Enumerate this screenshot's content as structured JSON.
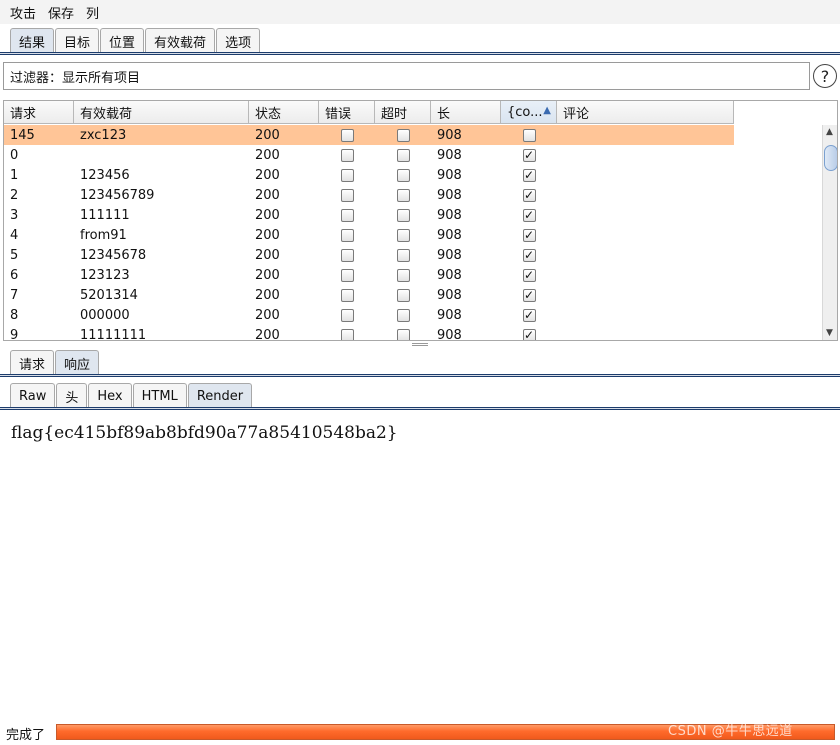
{
  "menu": [
    "攻击",
    "保存",
    "列"
  ],
  "top_tabs": [
    "结果",
    "目标",
    "位置",
    "有效载荷",
    "选项"
  ],
  "filter_text": "过滤器：显示所有项目",
  "help_glyph": "?",
  "table": {
    "columns": [
      "请求",
      "有效载荷",
      "状态",
      "错误",
      "超时",
      "长",
      "{co...",
      "评论"
    ],
    "sorted_column_arrow": "▲",
    "rows": [
      {
        "req": "145",
        "payload": "zxc123",
        "status": "200",
        "error": false,
        "timeout": false,
        "len": "908",
        "co": false,
        "comment": "",
        "selected": true
      },
      {
        "req": "0",
        "payload": "",
        "status": "200",
        "error": false,
        "timeout": false,
        "len": "908",
        "co": true,
        "comment": ""
      },
      {
        "req": "1",
        "payload": "123456",
        "status": "200",
        "error": false,
        "timeout": false,
        "len": "908",
        "co": true,
        "comment": ""
      },
      {
        "req": "2",
        "payload": "123456789",
        "status": "200",
        "error": false,
        "timeout": false,
        "len": "908",
        "co": true,
        "comment": ""
      },
      {
        "req": "3",
        "payload": "111111",
        "status": "200",
        "error": false,
        "timeout": false,
        "len": "908",
        "co": true,
        "comment": ""
      },
      {
        "req": "4",
        "payload": "from91",
        "status": "200",
        "error": false,
        "timeout": false,
        "len": "908",
        "co": true,
        "comment": ""
      },
      {
        "req": "5",
        "payload": "12345678",
        "status": "200",
        "error": false,
        "timeout": false,
        "len": "908",
        "co": true,
        "comment": ""
      },
      {
        "req": "6",
        "payload": "123123",
        "status": "200",
        "error": false,
        "timeout": false,
        "len": "908",
        "co": true,
        "comment": ""
      },
      {
        "req": "7",
        "payload": "5201314",
        "status": "200",
        "error": false,
        "timeout": false,
        "len": "908",
        "co": true,
        "comment": ""
      },
      {
        "req": "8",
        "payload": "000000",
        "status": "200",
        "error": false,
        "timeout": false,
        "len": "908",
        "co": true,
        "comment": ""
      },
      {
        "req": "9",
        "payload": "11111111",
        "status": "200",
        "error": false,
        "timeout": false,
        "len": "908",
        "co": true,
        "comment": ""
      }
    ]
  },
  "mid_tabs": [
    "请求",
    "响应"
  ],
  "sub_tabs": [
    "Raw",
    "头",
    "Hex",
    "HTML",
    "Render"
  ],
  "render_content": "flag{ec415bf89ab8bfd90a77a85410548ba2}",
  "status": "完成了",
  "progress": 1.0,
  "watermark": "CSDN @牛牛思远道",
  "colors": {
    "selected_row": "#ffc597",
    "progress": "#ff6a2b",
    "tab_active": "#dfe6ef"
  }
}
